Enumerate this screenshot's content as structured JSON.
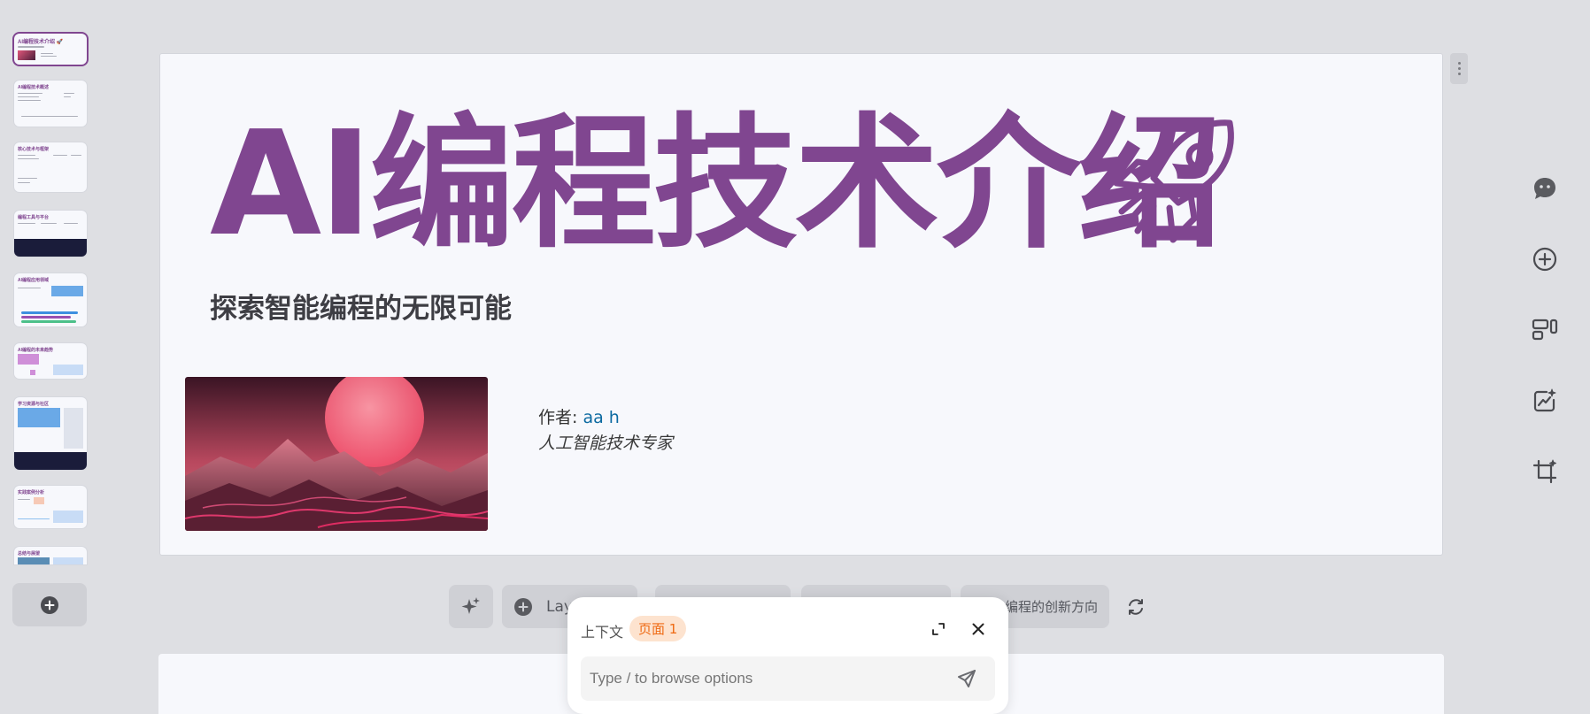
{
  "thumbnails": [
    {
      "title": "AI编程技术介绍 🚀"
    },
    {
      "title": "AI编程技术概述"
    },
    {
      "title": "核心技术与框架"
    },
    {
      "title": "编程工具与平台"
    },
    {
      "title": "AI编程应用领域"
    },
    {
      "title": "AI编程的未来趋势"
    },
    {
      "title": "学习资源与社区"
    },
    {
      "title": "实践案例分析"
    },
    {
      "title": "总结与展望"
    }
  ],
  "slide": {
    "title": "AI编程技术介绍",
    "subtitle": "探索智能编程的无限可能",
    "author_label": "作者: ",
    "author_name": "aa h",
    "author_role": "人工智能技术专家"
  },
  "toolbar": {
    "layout_label": "Lay",
    "suggestion_text": "编程的创新方向"
  },
  "chat": {
    "context_label": "上下文",
    "page_badge": "页面 1",
    "input_placeholder": "Type / to browse options"
  },
  "icons": {
    "add_slide": "plus-circle-icon",
    "rocket": "rocket-icon",
    "chat": "chat-bubble-icon",
    "add": "plus-circle-icon",
    "layout": "layout-icon",
    "chart_magic": "chart-sparkle-icon",
    "crop": "crop-sparkle-icon",
    "sparkle": "sparkle-icon",
    "refresh": "refresh-icon",
    "expand": "expand-icon",
    "close": "close-icon",
    "send": "send-icon"
  },
  "colors": {
    "accent": "#804690",
    "background": "#dedfe3",
    "slide_bg": "#f7f8fc",
    "badge_text": "#ef6a13",
    "badge_bg": "#fde3cf",
    "link": "#0c6aa1"
  }
}
